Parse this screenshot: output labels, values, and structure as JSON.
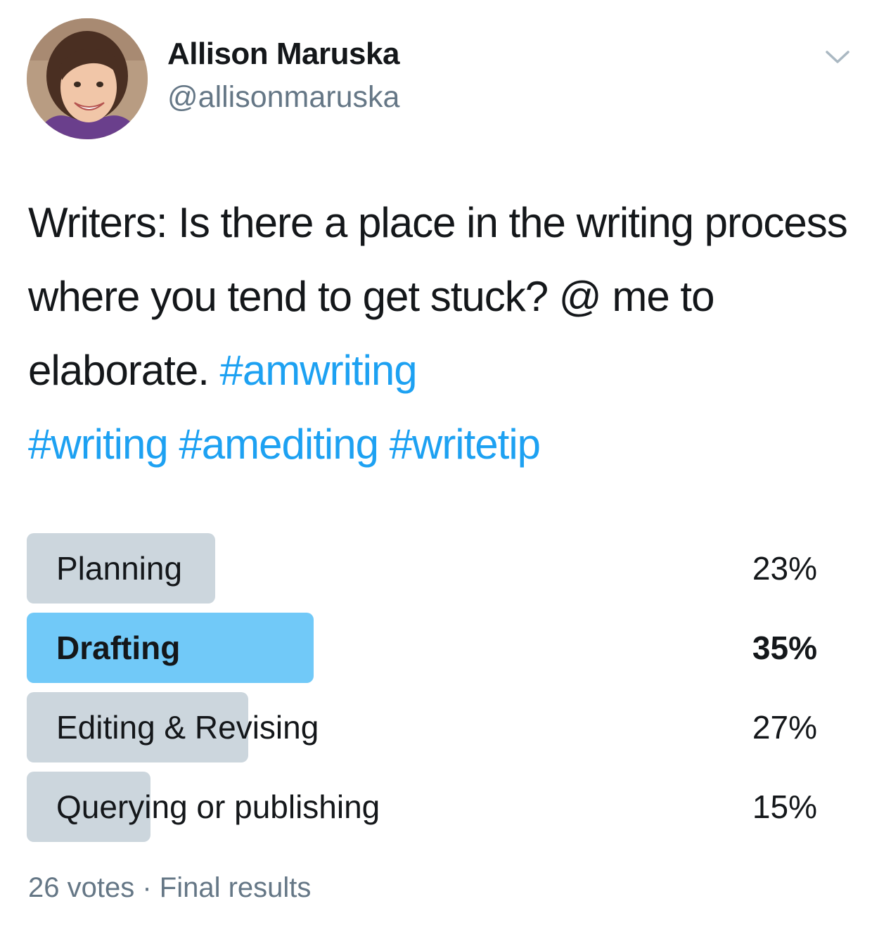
{
  "author": {
    "name": "Allison Maruska",
    "handle": "@allisonmaruska"
  },
  "tweet": {
    "text_plain": "Writers: Is there a place in the writing process where you tend to get stuck? @ me to elaborate.",
    "hashtags": [
      "#amwriting",
      "#writing",
      "#amediting",
      "#writetip"
    ]
  },
  "poll": {
    "options": [
      {
        "label": "Planning",
        "percent_text": "23%",
        "percent": 23,
        "winner": false
      },
      {
        "label": "Drafting",
        "percent_text": "35%",
        "percent": 35,
        "winner": true
      },
      {
        "label": "Editing & Revising",
        "percent_text": "27%",
        "percent": 27,
        "winner": false
      },
      {
        "label": "Querying or publishing",
        "percent_text": "15%",
        "percent": 15,
        "winner": false
      }
    ],
    "meta": "26 votes · Final results"
  },
  "icons": {
    "caret": "chevron-down-icon",
    "avatar": "profile-photo"
  },
  "colors": {
    "hashtag": "#1da1f2",
    "winner_bar": "#71c9f8",
    "bar": "#ccd6dd",
    "secondary_text": "#657786"
  }
}
